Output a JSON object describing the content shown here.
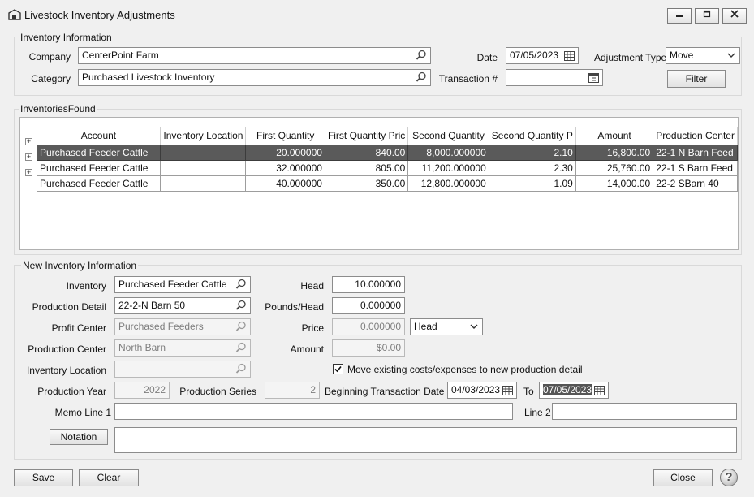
{
  "window": {
    "title": "Livestock Inventory Adjustments",
    "minimize_glyph": "▭",
    "restore_glyph": "❐",
    "close_glyph": "✕",
    "icon": "app-icon"
  },
  "inventory_info": {
    "legend": "Inventory Information",
    "company_label": "Company",
    "company_value": "CenterPoint Farm",
    "category_label": "Category",
    "category_value": "Purchased Livestock Inventory",
    "date_label": "Date",
    "date_value": "07/05/2023",
    "transaction_label": "Transaction #",
    "transaction_value": "",
    "adjustment_type_label": "Adjustment Type",
    "adjustment_type_value": "Move",
    "filter_label": "Filter"
  },
  "inventories_found": {
    "legend": "InventoriesFound",
    "columns": [
      "Account",
      "Inventory Location",
      "First Quantity",
      "First Quantity Pric",
      "Second Quantity",
      "Second Quantity P",
      "Amount",
      "Production Center"
    ],
    "rows": [
      {
        "account": "Purchased Feeder Cattle",
        "location": "",
        "first_qty": "20.000000",
        "first_price": "840.00",
        "second_qty": "8,000.000000",
        "second_price": "2.10",
        "amount": "16,800.00",
        "center": "22-1 N Barn Feed",
        "selected": true
      },
      {
        "account": "Purchased Feeder Cattle",
        "location": "",
        "first_qty": "32.000000",
        "first_price": "805.00",
        "second_qty": "11,200.000000",
        "second_price": "2.30",
        "amount": "25,760.00",
        "center": "22-1 S Barn Feed",
        "selected": false
      },
      {
        "account": "Purchased Feeder Cattle",
        "location": "",
        "first_qty": "40.000000",
        "first_price": "350.00",
        "second_qty": "12,800.000000",
        "second_price": "1.09",
        "amount": "14,000.00",
        "center": "22-2 SBarn 40",
        "selected": false
      }
    ],
    "expander_glyph": "+"
  },
  "new_info": {
    "legend": "New Inventory Information",
    "inventory_label": "Inventory",
    "inventory_value": "Purchased Feeder Cattle",
    "production_detail_label": "Production Detail",
    "production_detail_value": "22-2-N Barn 50",
    "profit_center_label": "Profit Center",
    "profit_center_value": "Purchased Feeders",
    "production_center_label": "Production Center",
    "production_center_value": "North Barn",
    "inventory_location_label": "Inventory Location",
    "inventory_location_value": "",
    "head_label": "Head",
    "head_value": "10.000000",
    "pounds_label": "Pounds/Head",
    "pounds_value": "0.000000",
    "price_label": "Price",
    "price_value": "0.000000",
    "price_unit_value": "Head",
    "amount_label": "Amount",
    "amount_value": "$0.00",
    "move_costs_label": "Move existing costs/expenses to new production detail",
    "move_costs_checked": true,
    "check_glyph": "✓",
    "production_year_label": "Production Year",
    "production_year_value": "2022",
    "production_series_label": "Production Series",
    "production_series_value": "2",
    "begin_date_label": "Beginning Transaction Date",
    "begin_date_value": "04/03/2023",
    "to_label": "To",
    "to_value": "07/05/2023",
    "memo1_label": "Memo Line 1",
    "memo1_value": "",
    "memo2_label": "Line 2",
    "memo2_value": "",
    "notation_label": "Notation",
    "notation_value": ""
  },
  "footer": {
    "save_label": "Save",
    "clear_label": "Clear",
    "close_label": "Close",
    "help_glyph": "?"
  }
}
